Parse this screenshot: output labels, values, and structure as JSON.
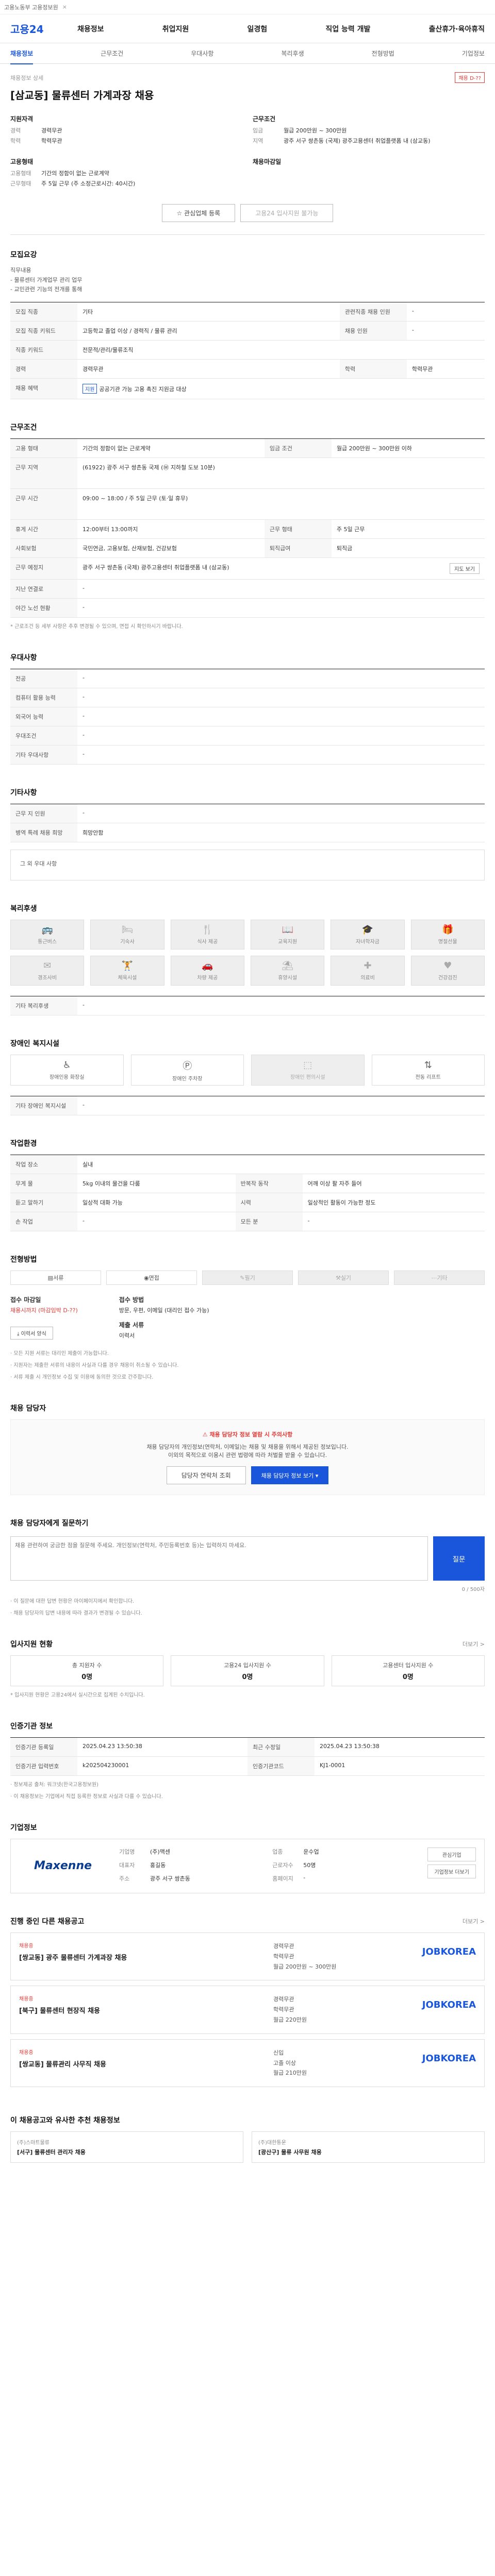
{
  "topbar": {
    "text": "고용노동부 고용정보원",
    "close": "×"
  },
  "header": {
    "logo": "고용24",
    "gnb": [
      "채용정보",
      "취업지원",
      "일경험",
      "직업 능력 개발",
      "출산휴가·육아휴직"
    ]
  },
  "subtabs": [
    "채용정보",
    "근무조건",
    "우대사항",
    "복리후생",
    "전형방법",
    "기업정보"
  ],
  "hero": {
    "crumb": "채용정보 상세",
    "badge": "채용 D-??",
    "title": "[삼교동] 물류센터 가계과장 채용",
    "left_title": "지원자격",
    "left": [
      {
        "k": "경력",
        "v": "경력무관"
      },
      {
        "k": "학력",
        "v": "학력무관"
      }
    ],
    "right_title": "근무조건",
    "right": [
      {
        "k": "임금",
        "v": "월급 200만원 ~ 300만원"
      },
      {
        "k": "지역",
        "v": "광주 서구 쌍촌동 (국제) 광주고용센터 취업플랫폼 내 (삼교동)"
      }
    ],
    "left2_title": "고용형태",
    "left2": [
      {
        "k": "고용형태",
        "v": "기간의 정함이 없는 근로계약"
      },
      {
        "k": "근무형태",
        "v": "주 5일 근무 (주 소정근로시간: 40시간)"
      }
    ],
    "right2_title": "채용마감일",
    "actions": [
      "관심업체 등록",
      "고용24 입사지원 불가능"
    ]
  },
  "recruit": {
    "title": "모집요강",
    "desc": "직무내용\n- 물류센터 가계업무 관리 업무\n- 교민관련 기능의 전개를 통해",
    "rows": [
      {
        "k": "모집 직종",
        "v": "기타",
        "k2": "관련직종 채용 인원",
        "v2": "-"
      },
      {
        "k": "모집 직종 키워드",
        "v": "고등학교 졸업 이상 / 경력직 / 물류 관리",
        "k2": "채용 인원",
        "v2": "-"
      },
      {
        "k": "직종 키워드",
        "v": "전문적/관리/물류조직",
        "k2": "",
        "v2": ""
      },
      {
        "k": "경력",
        "v": "경력무관",
        "k2": "학력",
        "v2": "학력무관"
      },
      {
        "k": "채용 혜택",
        "v": "공공기관 가능 고용 촉진 지원금 대상",
        "k2": "",
        "v2": ""
      }
    ]
  },
  "work": {
    "title": "근무조건",
    "rows": [
      {
        "k": "고용 형태",
        "v": "기간의 정함이 없는 근로계약",
        "k2": "임금 조건",
        "v2": "월급 200만원 ~ 300만원 이하"
      },
      {
        "k": "근무 지역",
        "v": "(61922) 광주 서구 쌍촌동 국제 (Ⓜ 지하철 도보 10분)",
        "k2": "",
        "v2": ""
      },
      {
        "k": "근무 시간",
        "v": "09:00 ~ 18:00 / 주 5일 근무 (토·일 휴무)",
        "k2": "",
        "v2": ""
      },
      {
        "k": "휴게 시간",
        "v": "12:00부터 13:00까지",
        "k2": "근무 형태",
        "v2": "주 5일 근무"
      },
      {
        "k": "사회보험",
        "v": "국민연금, 고용보험, 산재보험, 건강보험",
        "k2": "퇴직급여",
        "v2": "퇴직금"
      },
      {
        "k": "근무 예정지",
        "v": "광주 서구 쌍촌동 (국제) 광주고용센터 취업플랫폼 내 (삼교동)",
        "k2": "",
        "v2": "지도 보기"
      },
      {
        "k": "지난 연결로",
        "v": "-",
        "k2": "",
        "v2": ""
      },
      {
        "k": "야간 노선 현황",
        "v": "-",
        "k2": "",
        "v2": ""
      }
    ],
    "note": "* 근로조건 등 세부 사항은 추후 변경될 수 있으며, 면접 시 확인하시기 바랍니다."
  },
  "prefer": {
    "title": "우대사항",
    "rows": [
      {
        "k": "전공",
        "v": "-"
      },
      {
        "k": "컴퓨터 활용 능력",
        "v": "-"
      },
      {
        "k": "외국어 능력",
        "v": "-"
      },
      {
        "k": "우대조건",
        "v": "-"
      },
      {
        "k": "기타 우대사항",
        "v": "-"
      }
    ]
  },
  "etc": {
    "title": "기타사항",
    "rows": [
      {
        "k": "근무 지 인원",
        "v": "-"
      },
      {
        "k": "병역 특례 채용 희망",
        "v": "희망안함"
      }
    ],
    "more": "그 외 우대 사항"
  },
  "welfare": {
    "title": "복리후생",
    "items": [
      "통근버스",
      "기숙사",
      "식사 제공",
      "교육지원",
      "자녀학자금",
      "명절선물",
      "경조사비",
      "체육시설",
      "차량 제공",
      "휴양시설",
      "의료비",
      "건강검진"
    ],
    "more_label": "기타 복리후생",
    "more_value": "-"
  },
  "disability": {
    "title": "장애인 복지시설",
    "items": [
      "장애인용 화장실",
      "장애인 주차장",
      "장애인 편의시설",
      "전동 리프트"
    ],
    "more_label": "기타 장애인 복지시설",
    "more_value": "-"
  },
  "env": {
    "title": "작업환경",
    "rows": [
      {
        "k": "작업 장소",
        "v": "실내",
        "k2": "",
        "v2": ""
      },
      {
        "k": "무게 물",
        "v": "5kg 이내의 물건을 다룸",
        "k2": "반복작 동작",
        "v2": "어깨 이상 팔 자주 들어"
      },
      {
        "k": "듣고 말하기",
        "v": "일상적 대화 가능",
        "k2": "시력",
        "v2": "일상적인 활동이 가능한 정도"
      },
      {
        "k": "손 작업",
        "v": "-",
        "k2": "모든 분",
        "v2": "-"
      }
    ]
  },
  "process": {
    "title": "전형방법",
    "steps": [
      "서류",
      "면접",
      "필기",
      "실기",
      "기타"
    ],
    "apply_title": "접수 마감일",
    "apply_value": "채용시까지 (마감임박 D-??)",
    "method_title": "접수 방법",
    "method_value": "방문, 우편, 이메일 (대리인 접수 가능)",
    "docs_title": "제출 서류",
    "docs_value": "이력서",
    "docs_btn": "이력서 양식",
    "notes": [
      "· 모든 지원 서류는 대리인 제출이 가능합니다.",
      "· 지원자는 제출한 서류의 내용이 사실과 다를 경우 채용이 취소될 수 있습니다.",
      "· 서류 제출 시 개인정보 수집 및 이용에 동의한 것으로 간주합니다."
    ]
  },
  "contact": {
    "title": "채용 담당자",
    "alert": "채용 담당자 정보 열람 시 주의사항",
    "lines": [
      "채용 담당자의 개인정보(연락처, 이메일)는 채용 및 채용을 위해서 제공된 정보입니다.",
      "이외의 목적으로 이용시 관련 법령에 따라 처벌을 받을 수 있습니다."
    ],
    "btn1": "채용 담당자 정보 보기 ▾",
    "btn2": "담당자 연락처 조회"
  },
  "question": {
    "title": "채용 담당자에게 질문하기",
    "placeholder": "채용 관련하여 궁금한 점을 질문해 주세요. 개인정보(연락처, 주민등록번호 등)는 입력하지 마세요.",
    "submit": "질문",
    "count": "0 / 500자",
    "notes": [
      "· 이 질문에 대한 답변 현황은 마이페이지에서 확인합니다.",
      "· 채용 담당자의 답변 내용에 따라 결과가 변경될 수 있습니다."
    ]
  },
  "stats": {
    "title": "입사지원 현황",
    "more": "더보기 >",
    "items": [
      {
        "k": "총 지원자 수",
        "v": "0명"
      },
      {
        "k": "고용24 입사지원 수",
        "v": "0명"
      },
      {
        "k": "고용센터 입사지원 수",
        "v": "0명"
      }
    ],
    "note": "* 입사지원 현황은 고용24에서 실시간으로 집계된 수치입니다."
  },
  "info": {
    "title": "인증기관 정보",
    "rows": [
      {
        "k": "인증기관 등록일",
        "v": "2025.04.23 13:50:38",
        "k2": "최근 수정일",
        "v2": "2025.04.23 13:50:38"
      },
      {
        "k": "인증기관 입력번호",
        "v": "k202504230001",
        "k2": "인증기관코드",
        "v2": "KJ1-0001"
      }
    ],
    "notes": [
      "· 정보제공 출처: 워크넷(한국고용정보원)",
      "· 이 채용정보는 기업에서 직접 등록한 정보로 사실과 다를 수 있습니다."
    ]
  },
  "company": {
    "title": "기업정보",
    "logo": "Maxenne",
    "kvs": [
      {
        "k": "기업명",
        "v": "(주)맥센"
      },
      {
        "k": "업종",
        "v": "운수업"
      },
      {
        "k": "대표자",
        "v": "홍길동"
      },
      {
        "k": "근로자수",
        "v": "50명"
      },
      {
        "k": "주소",
        "v": "광주 서구 쌍촌동"
      },
      {
        "k": "홈페이지",
        "v": "-"
      }
    ],
    "btn1": "관심기업",
    "btn2": "기업정보 더보기"
  },
  "related": {
    "title": "진행 중인 다른 채용공고",
    "more": "더보기 >",
    "jobs": [
      {
        "tag": "채용중",
        "title": "[쌍교동] 광주 물류센터 가계과장 채용",
        "l1": "경력무관",
        "l2": "학력무관",
        "l3": "월급 200만원 ~ 300만원",
        "co": "JOBKOREA"
      },
      {
        "tag": "채용중",
        "title": "[북구] 물류센터 현장직 채용",
        "l1": "경력무관",
        "l2": "학력무관",
        "l3": "월급 220만원",
        "co": "JOBKOREA"
      },
      {
        "tag": "채용중",
        "title": "[쌍교동] 물류관리 사무직 채용",
        "l1": "신입",
        "l2": "고졸 이상",
        "l3": "월급 210만원",
        "co": "JOBKOREA"
      }
    ]
  },
  "recommend": {
    "title": "이 채용공고와 유사한 추천 채용정보",
    "items": [
      {
        "co": "(주)스마트물류",
        "t": "[서구] 물류센터 관리자 채용"
      },
      {
        "co": "(주)대한통운",
        "t": "[광산구] 물류 사무원 채용"
      }
    ]
  }
}
